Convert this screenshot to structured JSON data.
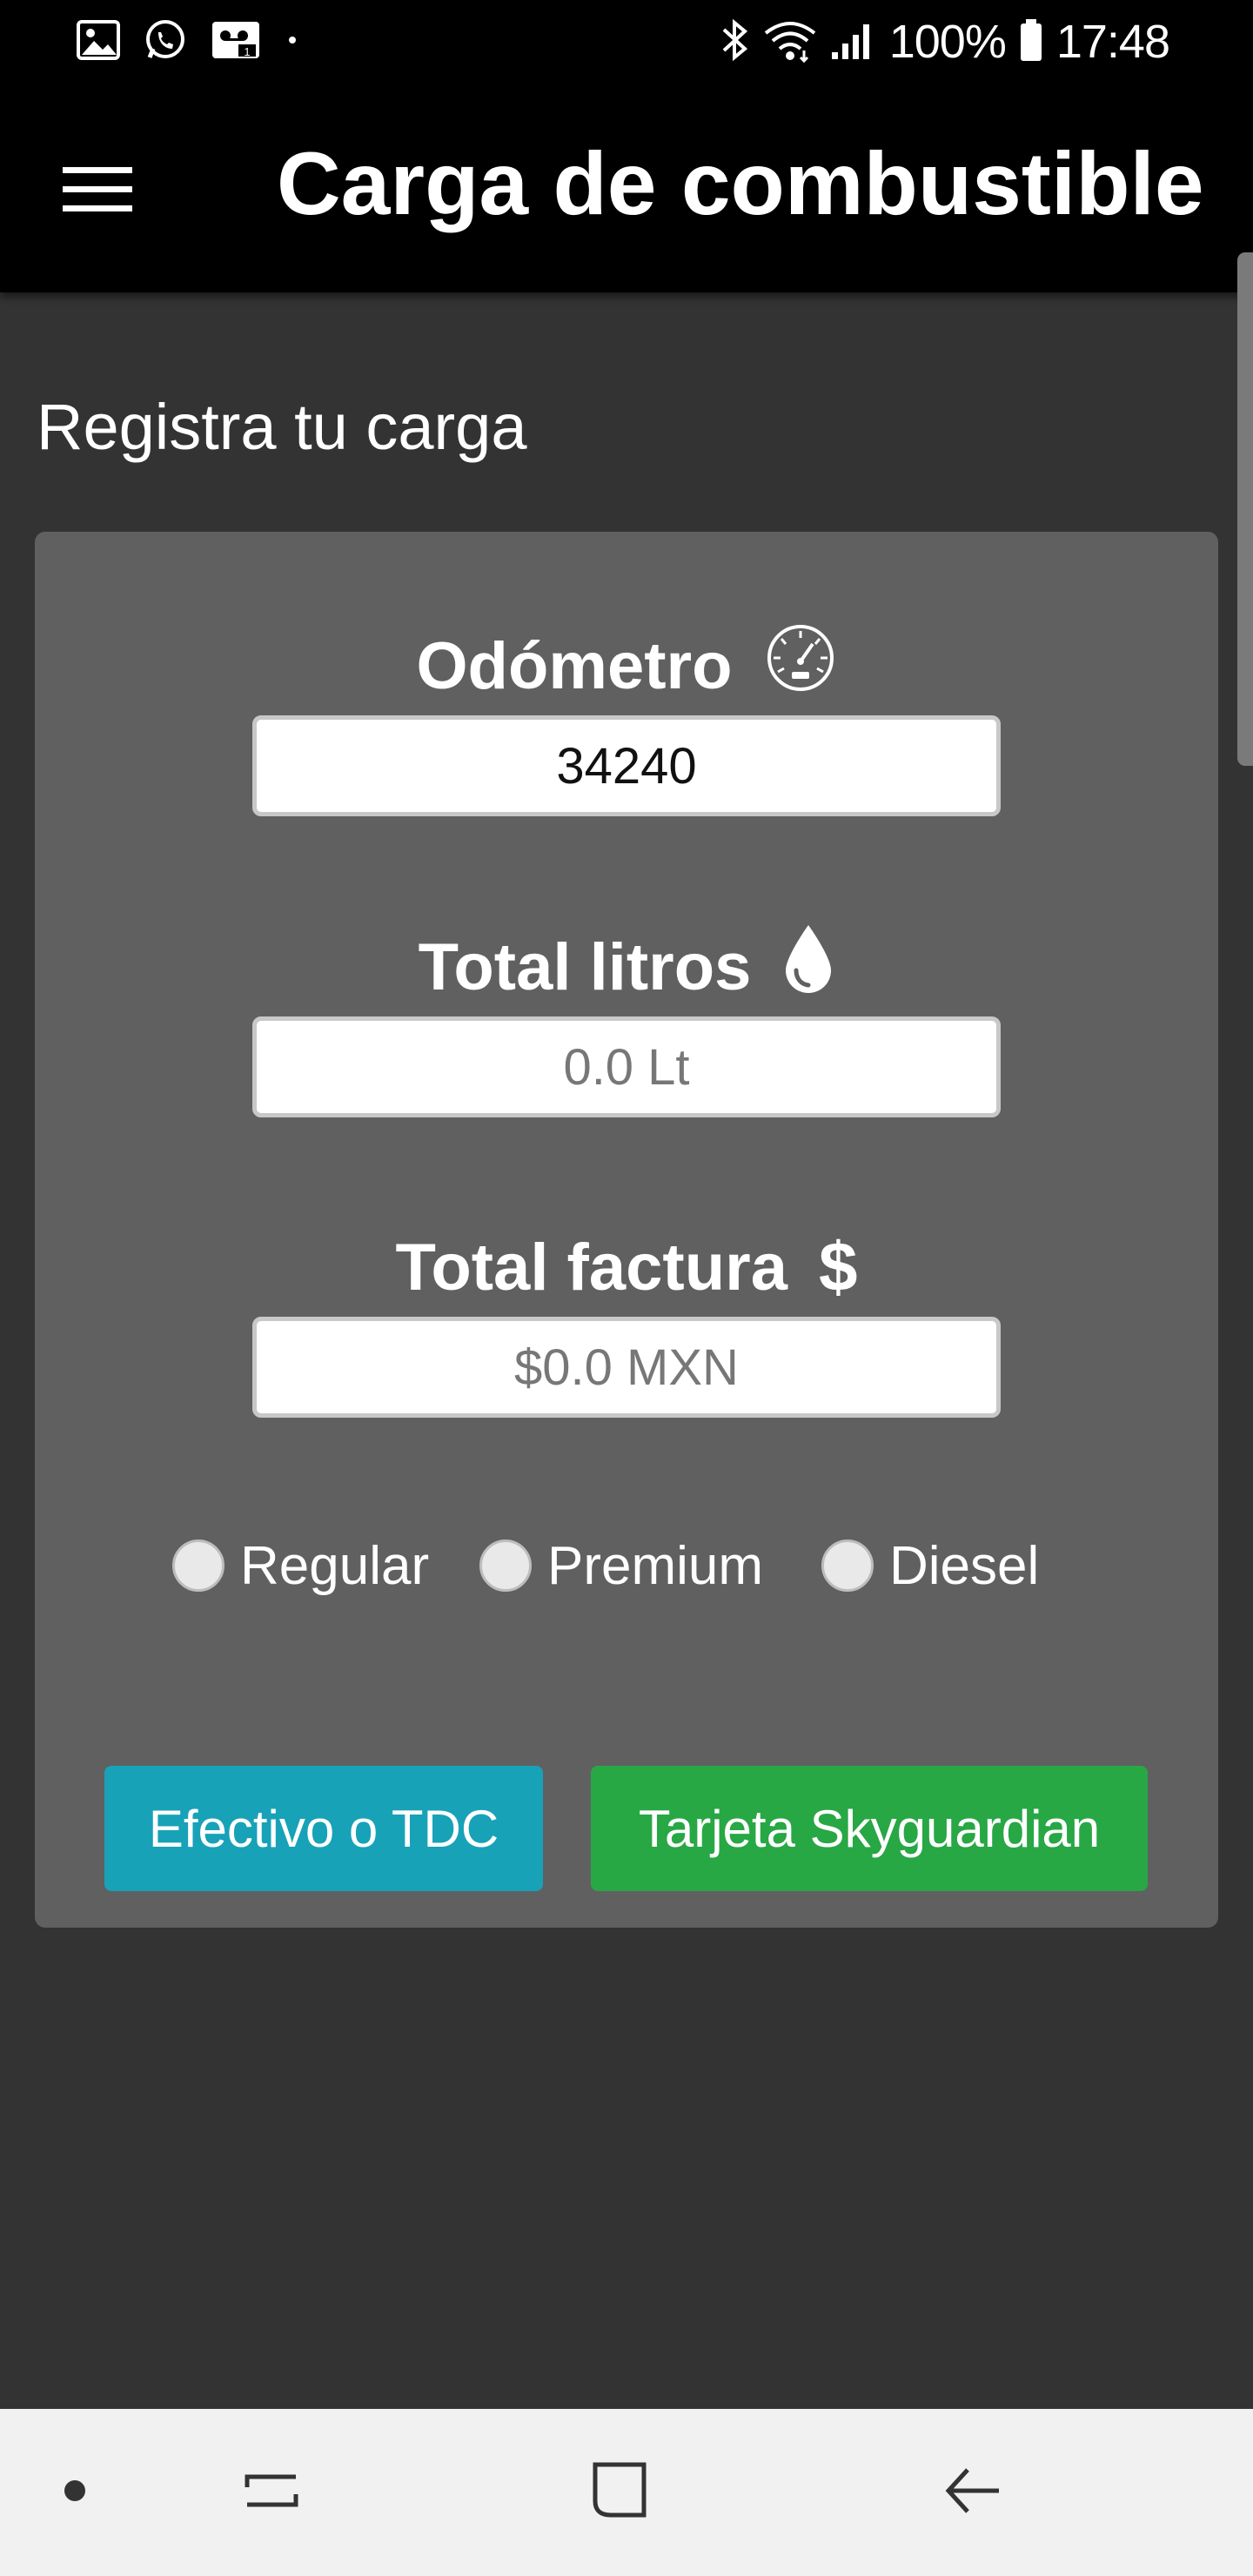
{
  "status_bar": {
    "battery": "100%",
    "time": "17:48",
    "left_icons": [
      "gallery-icon",
      "whatsapp-icon",
      "voicemail-icon",
      "notification-dot-icon"
    ],
    "right_icons": [
      "bluetooth-icon",
      "wifi-icon",
      "signal-icon",
      "battery-icon"
    ]
  },
  "toolbar": {
    "title": "Carga de combustible",
    "menu_icon": "hamburger-menu-icon"
  },
  "section": {
    "heading": "Registra tu carga"
  },
  "form": {
    "odometer": {
      "label": "Odómetro",
      "icon": "speedometer-icon",
      "value": "34240",
      "placeholder": ""
    },
    "liters": {
      "label": "Total litros",
      "icon": "drop-icon",
      "value": "",
      "placeholder": "0.0 Lt"
    },
    "invoice": {
      "label": "Total factura",
      "icon": "dollar-icon",
      "icon_glyph": "$",
      "value": "",
      "placeholder": "$0.0 MXN"
    },
    "fuel_types": [
      {
        "label": "Regular",
        "selected": false
      },
      {
        "label": "Premium",
        "selected": false
      },
      {
        "label": "Diesel",
        "selected": false
      }
    ]
  },
  "buttons": {
    "cash": "Efectivo o TDC",
    "card": "Tarjeta Skyguardian"
  },
  "nav_bar": {
    "items": [
      "nav-dot-icon",
      "recent-apps-icon",
      "home-icon",
      "back-icon"
    ]
  },
  "colors": {
    "background": "#333333",
    "card": "#606060",
    "toolbar": "#000000",
    "cash_button": "#17a2b8",
    "card_button": "#28a745",
    "nav_bar": "#f1f1f1"
  }
}
